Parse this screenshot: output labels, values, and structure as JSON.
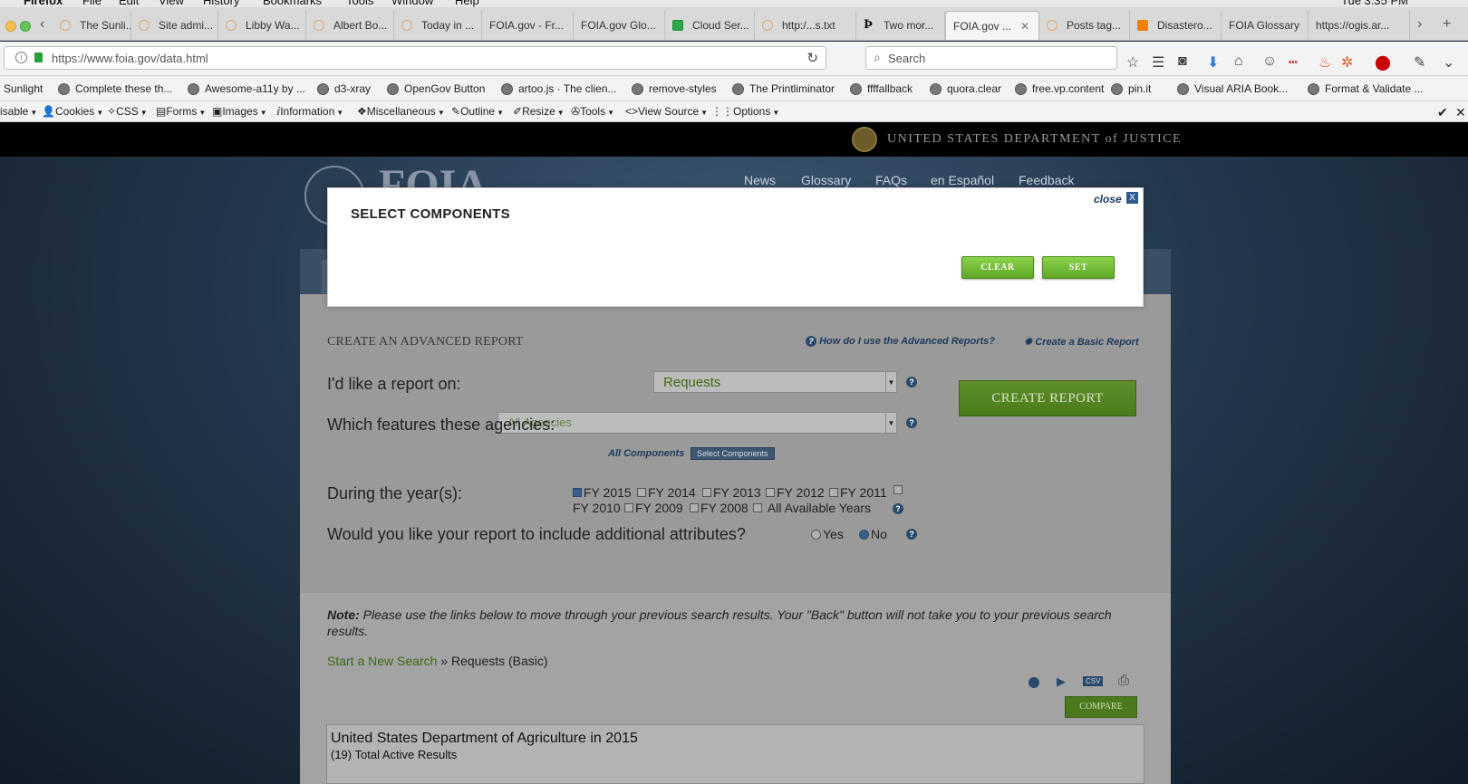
{
  "os_menu": [
    "Firefox",
    "File",
    "Edit",
    "View",
    "History",
    "Bookmarks",
    "Tools",
    "Window",
    "Help"
  ],
  "os_clock": "Tue 3:35 PM",
  "tabs": [
    {
      "label": "The Sunli..."
    },
    {
      "label": "Site admi..."
    },
    {
      "label": "Libby Wa..."
    },
    {
      "label": "Albert Bo..."
    },
    {
      "label": "Today in ..."
    },
    {
      "label": "FOIA.gov - Fr..."
    },
    {
      "label": "FOIA.gov Glo..."
    },
    {
      "label": "Cloud Ser..."
    },
    {
      "label": "http:/...s.txt"
    },
    {
      "label": "Two mor..."
    },
    {
      "label": "FOIA.gov ..."
    },
    {
      "label": "Posts tag..."
    },
    {
      "label": "Disastero..."
    },
    {
      "label": "FOIA Glossary"
    },
    {
      "label": "https://ogis.ar..."
    }
  ],
  "address": {
    "url": "https://www.foia.gov/data.html",
    "search_placeholder": "Search"
  },
  "bookmarks": [
    {
      "label": "Sunlight"
    },
    {
      "label": "Complete these th..."
    },
    {
      "label": "Awesome-a11y by ..."
    },
    {
      "label": "d3-xray"
    },
    {
      "label": "OpenGov Button"
    },
    {
      "label": "artoo.js · The clien..."
    },
    {
      "label": "remove-styles"
    },
    {
      "label": "The Printliminator"
    },
    {
      "label": "ffffallback"
    },
    {
      "label": "quora.clear"
    },
    {
      "label": "free.vp.content"
    },
    {
      "label": "pin.it"
    },
    {
      "label": "Visual ARIA Book..."
    },
    {
      "label": "Format & Validate ..."
    }
  ],
  "webdev_toolbar": [
    {
      "label": "isable"
    },
    {
      "label": "Cookies"
    },
    {
      "label": "CSS"
    },
    {
      "label": "Forms"
    },
    {
      "label": "Images"
    },
    {
      "label": "Information"
    },
    {
      "label": "Miscellaneous"
    },
    {
      "label": "Outline"
    },
    {
      "label": "Resize"
    },
    {
      "label": "Tools"
    },
    {
      "label": "View Source"
    },
    {
      "label": "Options"
    }
  ],
  "doj_header": "UNITED STATES DEPARTMENT of JUSTICE",
  "site_logo": "FOIA",
  "top_nav": [
    {
      "label": "News"
    },
    {
      "label": "Glossary"
    },
    {
      "label": "FAQs"
    },
    {
      "label": "en Español"
    },
    {
      "label": "Feedback"
    }
  ],
  "modal": {
    "title": "SELECT COMPONENTS",
    "close_label": "close",
    "close_x": "X",
    "clear_label": "CLEAR",
    "set_label": "SET"
  },
  "report": {
    "heading": "CREATE AN ADVANCED REPORT",
    "help_link": "How do I use the Advanced Reports?",
    "basic_link": "Create a Basic Report",
    "q_report_on": "I'd like a report on:",
    "report_on_value": "Requests",
    "q_agencies": "Which features these agencies:",
    "agencies_value": "All Agencies",
    "all_components": "All Components",
    "select_components": "Select Components",
    "create_button": "CREATE REPORT",
    "q_years": "During the year(s):",
    "years": [
      {
        "label": "FY 2015",
        "checked": true
      },
      {
        "label": "FY 2014",
        "checked": false
      },
      {
        "label": "FY 2013",
        "checked": false
      },
      {
        "label": "FY 2012",
        "checked": false
      },
      {
        "label": "FY 2011",
        "checked": false
      },
      {
        "label": "FY 2010",
        "checked": false
      },
      {
        "label": "FY 2009",
        "checked": false
      },
      {
        "label": "FY 2008",
        "checked": false
      },
      {
        "label": "All Available Years",
        "checked": false
      }
    ],
    "q_attributes": "Would you like your report to include additional attributes?",
    "attr_yes": "Yes",
    "attr_no": "No",
    "attr_selected": "No",
    "note_label": "Note:",
    "note_text": "Please use the links below to move through your previous search results. Your \"Back\" button will not take you to your previous search results.",
    "crumb_link": "Start a New Search",
    "crumb_sep": "»",
    "crumb_current": "Requests (Basic)",
    "csv_label": "CSV",
    "compare_label": "COMPARE",
    "result_title": "United States Department of Agriculture in 2015",
    "result_sub": "(19) Total Active Results"
  },
  "colors": {
    "modal_button": "#6fbd33",
    "create_button": "#4b7a1c",
    "link": "#1e3a5c",
    "doj_bar": "#000000"
  }
}
